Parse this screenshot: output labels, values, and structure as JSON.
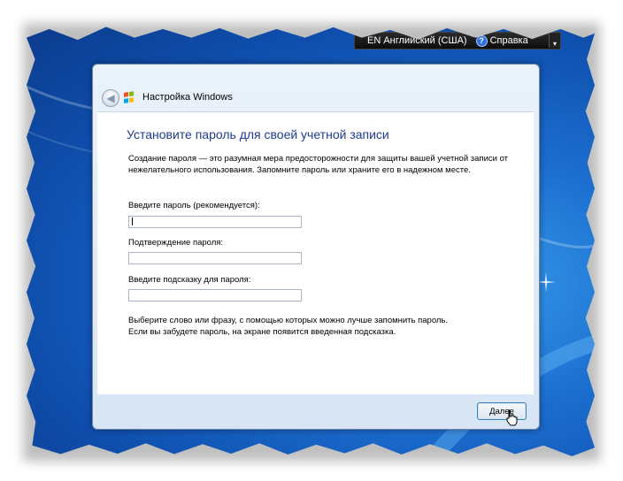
{
  "langbar": {
    "language": "EN Английский (США)",
    "help_label": "Справка",
    "help_glyph": "?",
    "menu_glyph": "▾"
  },
  "dialog": {
    "back_glyph": "◀",
    "title": "Настройка Windows",
    "heading": "Установите пароль для своей учетной записи",
    "description": "Создание пароля — это разумная мера предосторожности для защиты вашей учетной записи от нежелательного использования. Запомните пароль или храните его в надежном месте.",
    "password_label": "Введите пароль (рекомендуется):",
    "confirm_label": "Подтверждение пароля:",
    "hint_label": "Введите подсказку для пароля:",
    "password_value": "",
    "confirm_value": "",
    "hint_value": "",
    "hint_note_line1": "Выберите слово или фразу, с помощью которых можно лучше запомнить пароль.",
    "hint_note_line2": "Если вы забудете пароль, на экране появится введенная подсказка.",
    "next_button": "Далее"
  },
  "icons": {
    "windows_logo_colors": [
      "#f25022",
      "#7fba00",
      "#00a4ef",
      "#ffb900"
    ],
    "help_icon_color": "#2f6fe0"
  }
}
